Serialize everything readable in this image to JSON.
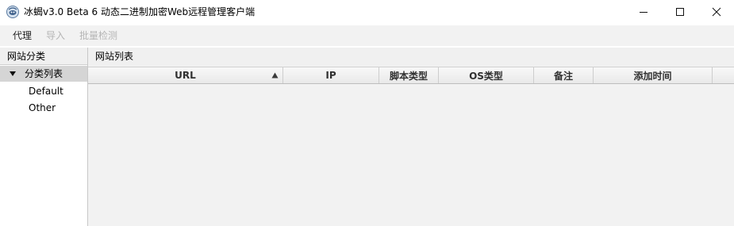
{
  "window": {
    "title": "冰蝎v3.0 Beta 6 动态二进制加密Web远程管理客户端",
    "app_icon": "scorpion-app-icon",
    "controls": [
      "minimize-icon",
      "maximize-icon",
      "close-icon"
    ]
  },
  "menu": {
    "items": [
      {
        "label": "代理",
        "enabled": true
      },
      {
        "label": "导入",
        "enabled": false
      },
      {
        "label": "批量检测",
        "enabled": false
      }
    ]
  },
  "left_panel": {
    "title": "网站分类",
    "tree": {
      "root_label": "分类列表",
      "expanded": true,
      "selected": true,
      "children": [
        "Default",
        "Other"
      ]
    }
  },
  "right_panel": {
    "title": "网站列表",
    "table": {
      "columns": [
        "URL",
        "IP",
        "脚本类型",
        "OS类型",
        "备注",
        "添加时间"
      ],
      "sorted_column": "URL",
      "sort_direction": "ascending",
      "rows": []
    }
  },
  "colors": {
    "selection": "#d5d5d5",
    "menubar": "#f2f2f2",
    "disabled_text": "#b5b5b5"
  }
}
